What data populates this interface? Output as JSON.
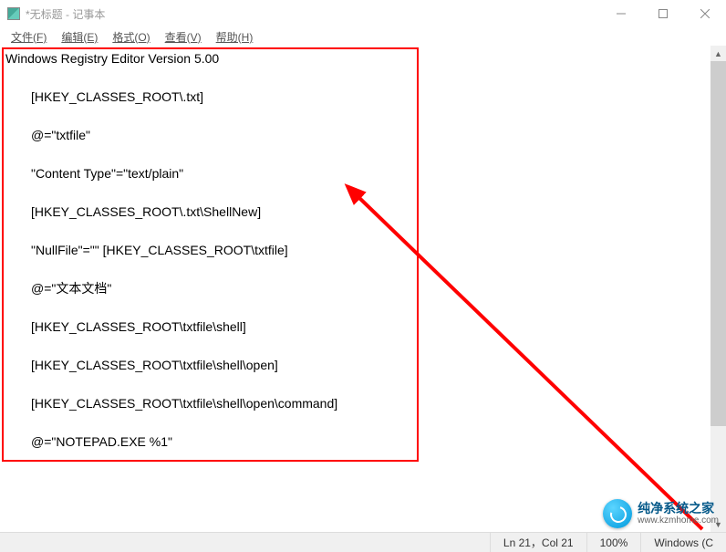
{
  "titlebar": {
    "title": "*无标题 - 记事本"
  },
  "menubar": {
    "items": [
      {
        "label": "文件(F)"
      },
      {
        "label": "编辑(E)"
      },
      {
        "label": "格式(O)"
      },
      {
        "label": "查看(V)"
      },
      {
        "label": "帮助(H)"
      }
    ]
  },
  "editor": {
    "lines": [
      {
        "text": "Windows Registry Editor Version 5.00",
        "indented": false
      },
      {
        "blank": true
      },
      {
        "text": "[HKEY_CLASSES_ROOT\\.txt]",
        "indented": true
      },
      {
        "blank": true
      },
      {
        "text": "@=\"txtfile\"",
        "indented": true
      },
      {
        "blank": true
      },
      {
        "text": "\"Content Type\"=\"text/plain\"",
        "indented": true
      },
      {
        "blank": true
      },
      {
        "text": "[HKEY_CLASSES_ROOT\\.txt\\ShellNew]",
        "indented": true
      },
      {
        "blank": true
      },
      {
        "text": "\"NullFile\"=\"\" [HKEY_CLASSES_ROOT\\txtfile]",
        "indented": true
      },
      {
        "blank": true
      },
      {
        "text": "@=\"文本文档\"",
        "indented": true
      },
      {
        "blank": true
      },
      {
        "text": "[HKEY_CLASSES_ROOT\\txtfile\\shell]",
        "indented": true
      },
      {
        "blank": true
      },
      {
        "text": "[HKEY_CLASSES_ROOT\\txtfile\\shell\\open]",
        "indented": true
      },
      {
        "blank": true
      },
      {
        "text": "[HKEY_CLASSES_ROOT\\txtfile\\shell\\open\\command]",
        "indented": true
      },
      {
        "blank": true
      },
      {
        "text": "@=\"NOTEPAD.EXE %1\"",
        "indented": true
      }
    ]
  },
  "statusbar": {
    "position": "Ln 21，Col 21",
    "zoom": "100%",
    "encoding": "Windows (C"
  },
  "watermark": {
    "name": "纯净系统之家",
    "url": "www.kzmhome.com"
  },
  "annotation": {
    "color": "#ff0000"
  }
}
